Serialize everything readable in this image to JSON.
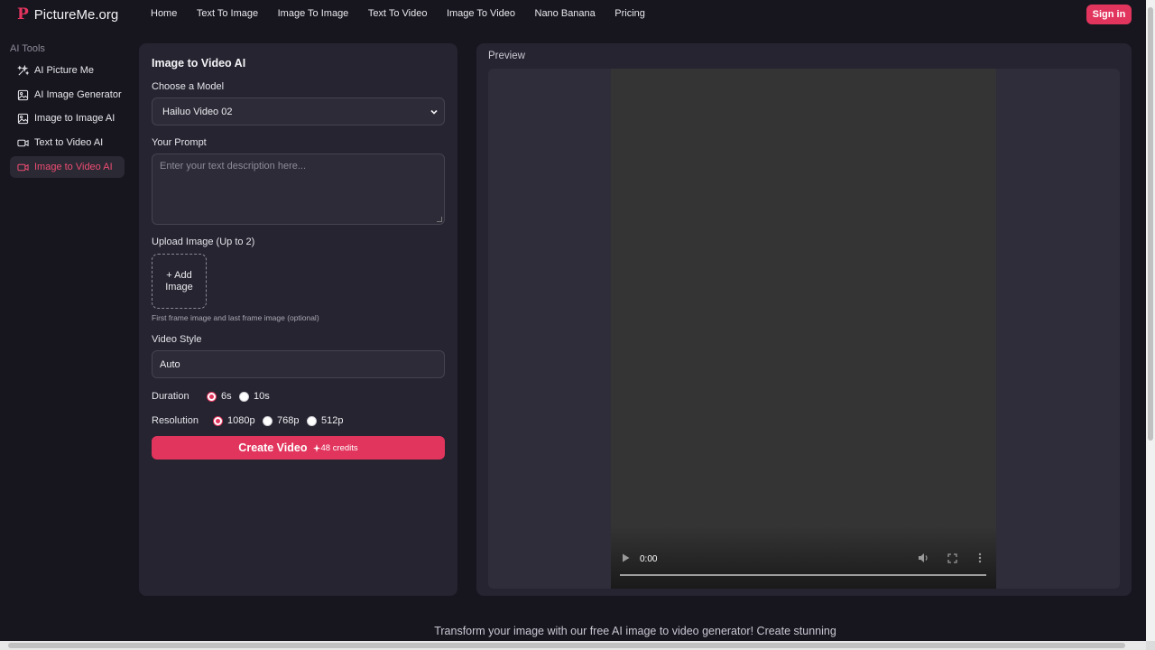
{
  "brand": {
    "mark": "P",
    "name": "PictureMe.org",
    "accent": "#e2355d"
  },
  "nav": [
    "Home",
    "Text To Image",
    "Image To Image",
    "Text To Video",
    "Image To Video",
    "Nano Banana",
    "Pricing"
  ],
  "header": {
    "signin_label": "Sign in"
  },
  "sidebar": {
    "heading": "AI Tools",
    "items": [
      {
        "label": "AI Picture Me",
        "icon": "sparkles-icon",
        "active": false
      },
      {
        "label": "AI Image Generator",
        "icon": "image-icon",
        "active": false
      },
      {
        "label": "Image to Image AI",
        "icon": "image-icon",
        "active": false
      },
      {
        "label": "Text to Video AI",
        "icon": "video-icon",
        "active": false
      },
      {
        "label": "Image to Video AI",
        "icon": "video-icon",
        "active": true
      }
    ]
  },
  "form": {
    "title": "Image to Video AI",
    "model_label": "Choose a Model",
    "model_value": "Hailuo Video 02",
    "prompt_label": "Your Prompt",
    "prompt_placeholder": "Enter your text description here...",
    "upload_label": "Upload Image (Up to 2)",
    "upload_button_line1": "+ Add",
    "upload_button_line2": "Image",
    "upload_hint": "First frame image and last frame image (optional)",
    "style_label": "Video Style",
    "style_value": "Auto",
    "duration_label": "Duration",
    "duration_options": [
      "6s",
      "10s"
    ],
    "duration_selected": "6s",
    "resolution_label": "Resolution",
    "resolution_options": [
      "1080p",
      "768p",
      "512p"
    ],
    "resolution_selected": "1080p",
    "create_label": "Create Video",
    "credits": "48 credits"
  },
  "preview": {
    "title": "Preview",
    "time": "0:00"
  },
  "footer": {
    "tagline": "Transform your image with our free AI image to video generator! Create stunning"
  }
}
